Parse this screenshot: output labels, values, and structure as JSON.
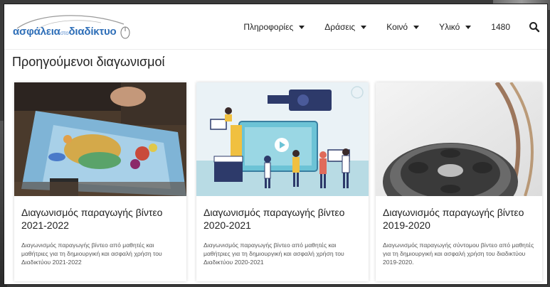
{
  "site": {
    "logo": {
      "part1": "ασφάλεια",
      "part2": "στο",
      "part3": "διαδίκτυο"
    }
  },
  "nav": {
    "items": [
      {
        "label": "Πληροφορίες",
        "has_dropdown": true
      },
      {
        "label": "Δράσεις",
        "has_dropdown": true
      },
      {
        "label": "Κοινό",
        "has_dropdown": true
      },
      {
        "label": "Υλικό",
        "has_dropdown": true
      },
      {
        "label": "1480",
        "has_dropdown": false
      }
    ],
    "search_icon": "search-icon"
  },
  "page": {
    "title": "Προηγούμενοι διαγωνισμοί"
  },
  "cards": [
    {
      "title": "Διαγωνισμός παραγωγής βίντεο 2021-2022",
      "description": "Διαγωνισμός παραγωγής βίντεο από μαθητές και μαθήτριες για τη δημιουργική και ασφαλή χρήση του Διαδικτύου 2021-2022"
    },
    {
      "title": "Διαγωνισμός παραγωγής βίντεο 2020-2021",
      "description": "Διαγωνισμός παραγωγής βίντεο από μαθητές και μαθήτριες για τη δημιουργική και ασφαλή χρήση του Διαδικτύου 2020-2021"
    },
    {
      "title": "Διαγωνισμός παραγωγής βίντεο 2019-2020",
      "description": "Διαγωνισμός παραγωγής σύντομου βίντεο από μαθητές για τη δημιουργική και ασφαλή χρήση του διαδικτύου 2019-2020."
    }
  ],
  "colors": {
    "brand_blue": "#2f6fb8",
    "text_dark": "#222222",
    "text_muted": "#555555"
  }
}
